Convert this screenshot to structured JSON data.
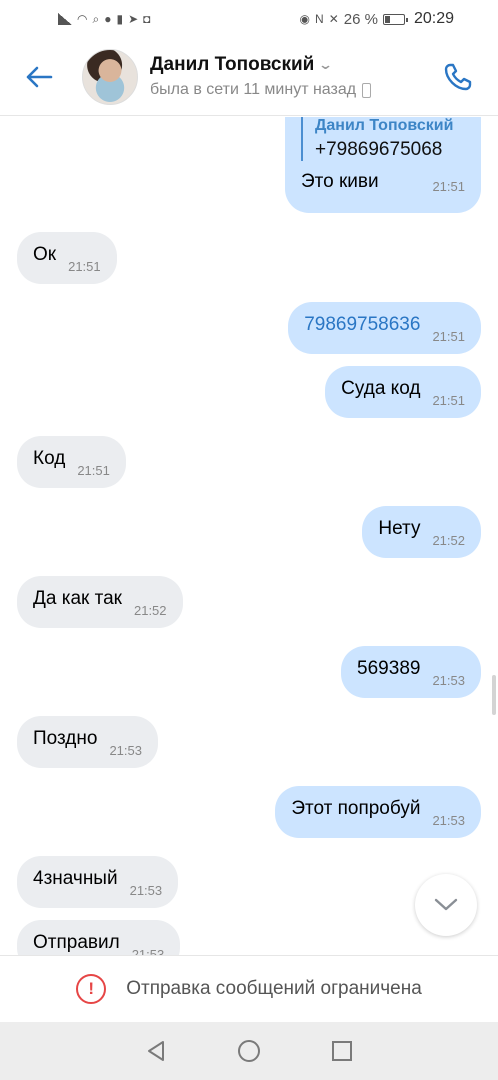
{
  "status_bar": {
    "battery_percent": "26 %",
    "time": "20:29"
  },
  "header": {
    "name": "Данил Топовский",
    "status": "была в сети 11 минут назад"
  },
  "forwarded": {
    "author": "Данил Топовский",
    "phone": "+79869675068",
    "text": "Это киви",
    "time": "21:51"
  },
  "messages": [
    {
      "dir": "in",
      "text": "Ок",
      "time": "21:51"
    },
    {
      "dir": "out",
      "text": "79869758636",
      "time": "21:51"
    },
    {
      "dir": "out",
      "text": "Суда код",
      "time": "21:51"
    },
    {
      "dir": "in",
      "text": "Код",
      "time": "21:51"
    },
    {
      "dir": "out",
      "text": "Нету",
      "time": "21:52"
    },
    {
      "dir": "in",
      "text": "Да как так",
      "time": "21:52"
    },
    {
      "dir": "out",
      "text": "569389",
      "time": "21:53"
    },
    {
      "dir": "in",
      "text": "Поздно",
      "time": "21:53"
    },
    {
      "dir": "out",
      "text": "Этот попробуй",
      "time": "21:53"
    },
    {
      "dir": "in",
      "text": "4значный",
      "time": "21:53"
    },
    {
      "dir": "in",
      "text": "Отправил",
      "time": "21:53"
    }
  ],
  "notice": {
    "text": "Отправка сообщений ограничена"
  },
  "colors": {
    "accent": "#2a76c4",
    "outgoing_bubble": "#cce4ff",
    "incoming_bubble": "#ebedf0",
    "warning": "#e64646"
  }
}
